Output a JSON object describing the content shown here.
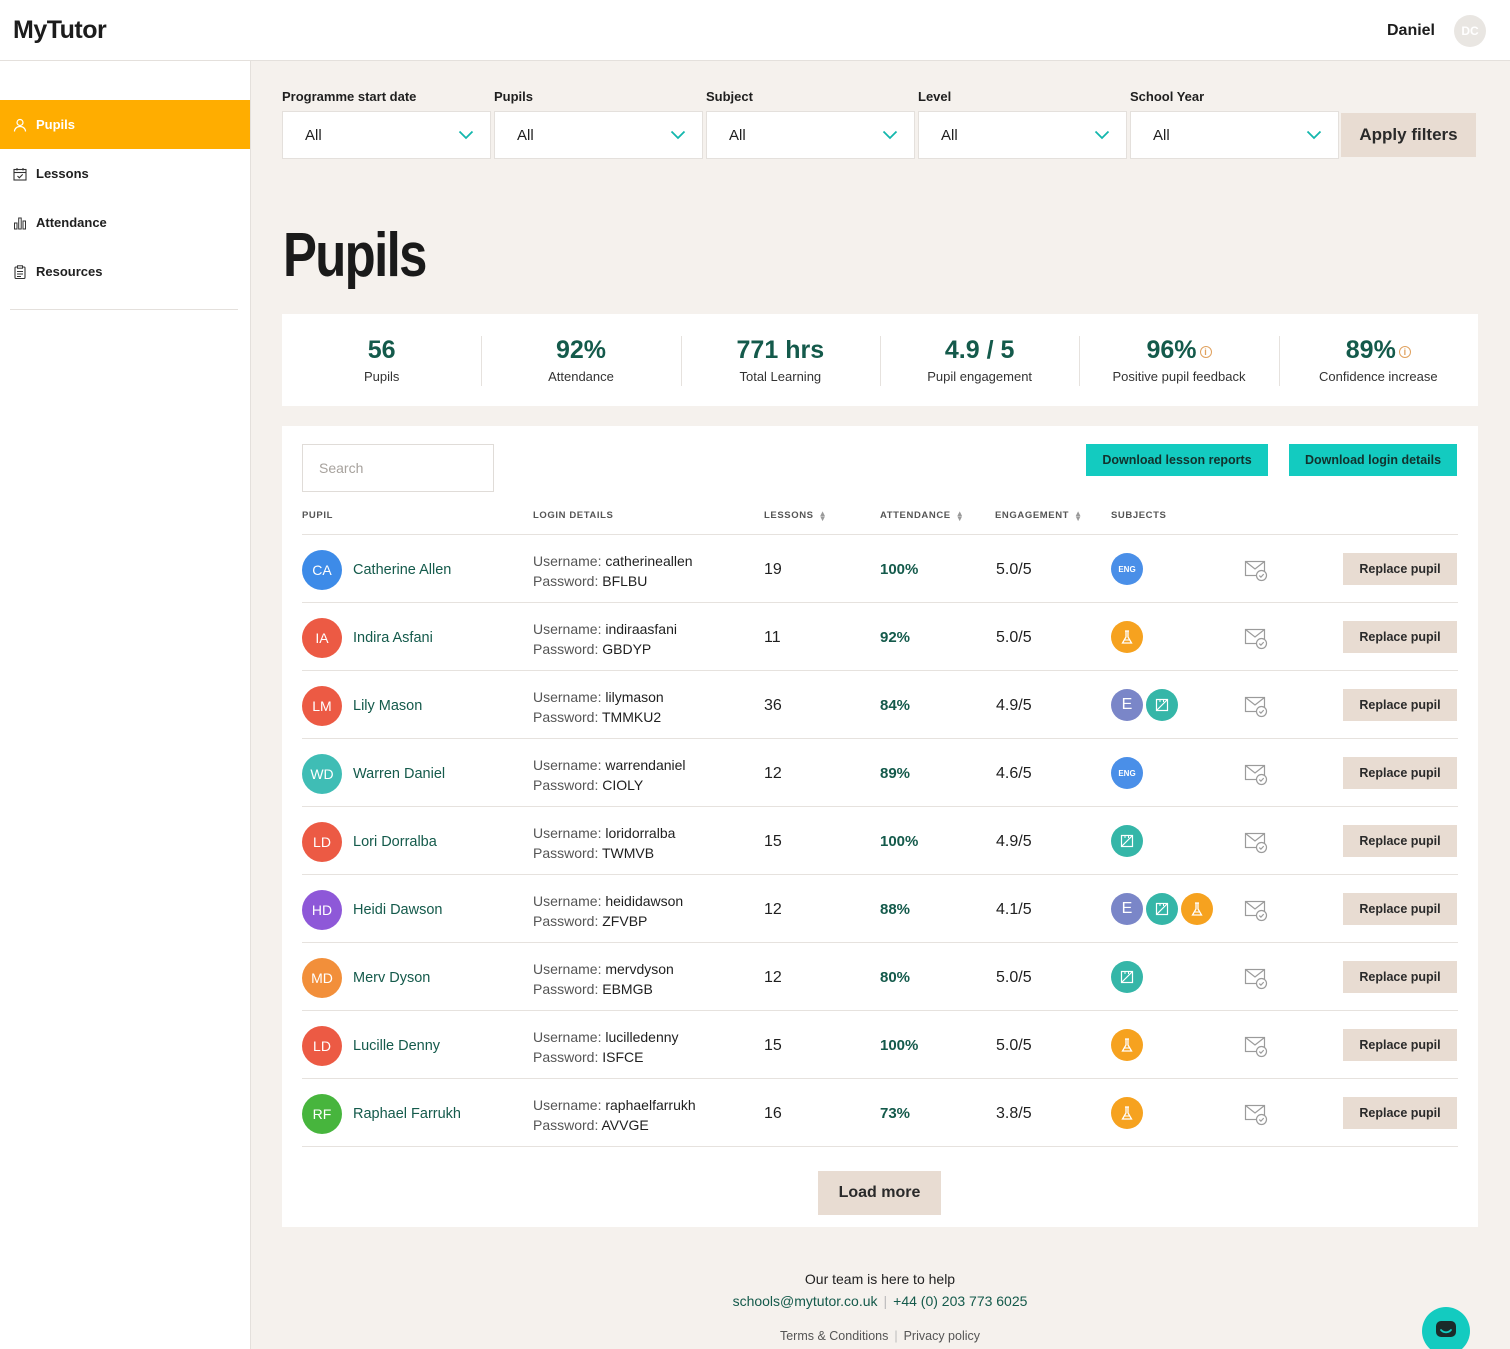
{
  "app": {
    "logo": "MyTutor"
  },
  "header": {
    "user_name": "Daniel",
    "user_initials": "DC"
  },
  "sidebar": {
    "items": [
      {
        "label": "Pupils",
        "icon": "user-icon",
        "active": true
      },
      {
        "label": "Lessons",
        "icon": "calendar-icon",
        "active": false
      },
      {
        "label": "Attendance",
        "icon": "bar-chart-icon",
        "active": false
      },
      {
        "label": "Resources",
        "icon": "clipboard-icon",
        "active": false
      }
    ]
  },
  "filters": {
    "items": [
      {
        "label": "Programme start date",
        "value": "All"
      },
      {
        "label": "Pupils",
        "value": "All"
      },
      {
        "label": "Subject",
        "value": "All"
      },
      {
        "label": "Level",
        "value": "All"
      },
      {
        "label": "School Year",
        "value": "All"
      }
    ],
    "apply_label": "Apply filters"
  },
  "page": {
    "title": "Pupils"
  },
  "stats": [
    {
      "value": "56",
      "label": "Pupils",
      "info": false
    },
    {
      "value": "92%",
      "label": "Attendance",
      "info": false
    },
    {
      "value": "771 hrs",
      "label": "Total Learning",
      "info": false
    },
    {
      "value": "4.9 / 5",
      "label": "Pupil engagement",
      "info": false
    },
    {
      "value": "96%",
      "label": "Positive pupil feedback",
      "info": true
    },
    {
      "value": "89%",
      "label": "Confidence increase",
      "info": true
    }
  ],
  "table": {
    "search_placeholder": "Search",
    "download_reports_label": "Download lesson reports",
    "download_login_label": "Download login details",
    "columns": {
      "pupil": "PUPIL",
      "login": "LOGIN DETAILS",
      "lessons": "LESSONS",
      "attendance": "ATTENDANCE",
      "engagement": "ENGAGEMENT",
      "subjects": "SUBJECTS"
    },
    "username_label": "Username:",
    "password_label": "Password:",
    "replace_label": "Replace pupil",
    "eng_badge": "ENG",
    "e_badge": "E",
    "rows": [
      {
        "initials": "CA",
        "color": "#3d8be8",
        "name": "Catherine Allen",
        "username": "catherineallen",
        "password": "BFLBU",
        "lessons": "19",
        "attendance": "100%",
        "engagement": "5.0/5",
        "subjects": [
          "eng"
        ]
      },
      {
        "initials": "IA",
        "color": "#ec5a44",
        "name": "Indira Asfani",
        "username": "indiraasfani",
        "password": "GBDYP",
        "lessons": "11",
        "attendance": "92%",
        "engagement": "5.0/5",
        "subjects": [
          "o"
        ]
      },
      {
        "initials": "LM",
        "color": "#ec5a44",
        "name": "Lily Mason",
        "username": "lilymason",
        "password": "TMMKU2",
        "lessons": "36",
        "attendance": "84%",
        "engagement": "4.9/5",
        "subjects": [
          "e",
          "t"
        ]
      },
      {
        "initials": "WD",
        "color": "#3fbdb5",
        "name": "Warren Daniel",
        "username": "warrendaniel",
        "password": "CIOLY",
        "lessons": "12",
        "attendance": "89%",
        "engagement": "4.6/5",
        "subjects": [
          "eng"
        ]
      },
      {
        "initials": "LD",
        "color": "#ec5a44",
        "name": "Lori Dorralba",
        "username": "loridorralba",
        "password": "TWMVB",
        "lessons": "15",
        "attendance": "100%",
        "engagement": "4.9/5",
        "subjects": [
          "t"
        ]
      },
      {
        "initials": "HD",
        "color": "#8e58d8",
        "name": "Heidi Dawson",
        "username": "heididawson",
        "password": "ZFVBP",
        "lessons": "12",
        "attendance": "88%",
        "engagement": "4.1/5",
        "subjects": [
          "e",
          "t",
          "o"
        ]
      },
      {
        "initials": "MD",
        "color": "#f28f3a",
        "name": "Merv Dyson",
        "username": "mervdyson",
        "password": "EBMGB",
        "lessons": "12",
        "attendance": "80%",
        "engagement": "5.0/5",
        "subjects": [
          "t"
        ]
      },
      {
        "initials": "LD",
        "color": "#ec5a44",
        "name": "Lucille Denny",
        "username": "lucilledenny",
        "password": "ISFCE",
        "lessons": "15",
        "attendance": "100%",
        "engagement": "5.0/5",
        "subjects": [
          "o"
        ]
      },
      {
        "initials": "RF",
        "color": "#47b53d",
        "name": "Raphael Farrukh",
        "username": "raphaelfarrukh",
        "password": "AVVGE",
        "lessons": "16",
        "attendance": "73%",
        "engagement": "3.8/5",
        "subjects": [
          "o"
        ]
      }
    ],
    "load_more_label": "Load more"
  },
  "footer": {
    "help": "Our team is here to help",
    "email": "schools@mytutor.co.uk",
    "phone": "+44 (0) 203 773 6025",
    "terms": "Terms & Conditions",
    "privacy": "Privacy policy"
  }
}
